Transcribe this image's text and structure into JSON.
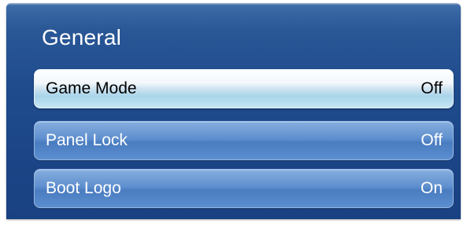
{
  "menu": {
    "title": "General",
    "items": [
      {
        "label": "Game Mode",
        "value": "Off",
        "selected": true
      },
      {
        "label": "Panel Lock",
        "value": "Off",
        "selected": false
      },
      {
        "label": "Boot Logo",
        "value": "On",
        "selected": false
      }
    ]
  },
  "colors": {
    "panel_background": "#1f4b8d",
    "item_normal": "#5f8fcf",
    "item_selected": "#cfe3f0",
    "text_light": "#ffffff",
    "text_dark": "#000000"
  }
}
